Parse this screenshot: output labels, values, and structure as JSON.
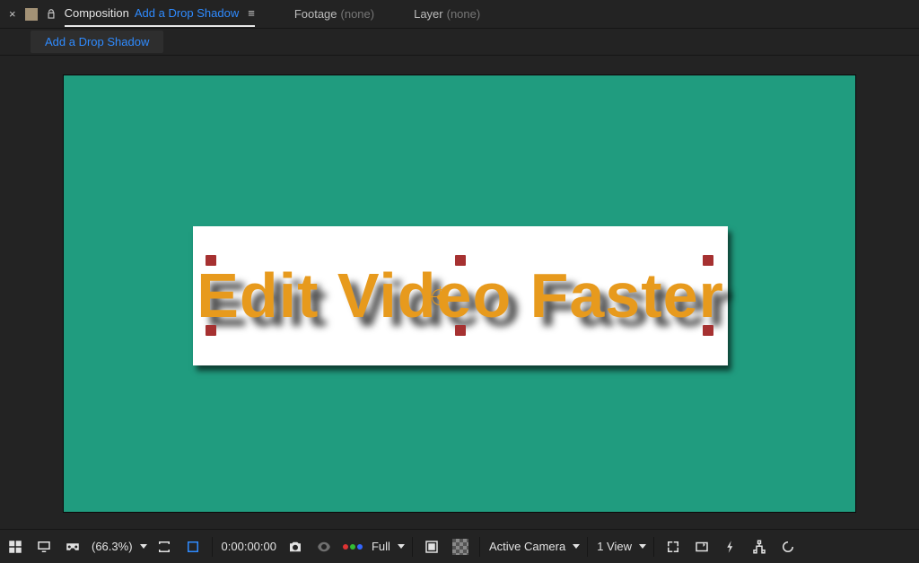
{
  "tabs": {
    "composition": {
      "label_static": "Composition",
      "label_link": "Add a Drop Shadow"
    },
    "footage": {
      "label": "Footage",
      "state": "(none)"
    },
    "layer": {
      "label": "Layer",
      "state": "(none)"
    }
  },
  "breadcrumb": {
    "item": "Add a Drop Shadow"
  },
  "canvas": {
    "title_text": "Edit Video Faster"
  },
  "bottom": {
    "zoom": "(66.3%)",
    "timecode": "0:00:00:00",
    "resolution": "Full",
    "camera": "Active Camera",
    "views": "1 View"
  }
}
